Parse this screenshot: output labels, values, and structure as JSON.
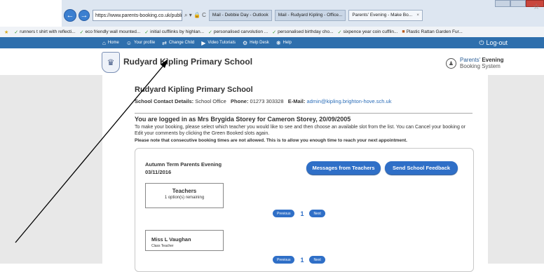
{
  "browser": {
    "url": "https://www.parents-booking.co.uk/public/b",
    "addr_icons": "⌕ ▾ 🔒 C",
    "tabs": [
      {
        "label": "Mail - Debbie Day - Outlook",
        "active": false
      },
      {
        "label": "Mail - Rudyard Kipling - Office...",
        "active": false
      },
      {
        "label": "Parents' Evening - Make Bo...",
        "active": true
      }
    ],
    "favorites": [
      "runners t shirt with reflecti...",
      "eco friendly wall mounted...",
      "initial cufflinks by highlan...",
      "personalised carvolution ...",
      "personalised birthday cho...",
      "sixpence year coin cufflin...",
      "Plastic Rattan Garden Fur..."
    ]
  },
  "site_nav": {
    "items": [
      {
        "icon": "home-icon",
        "label": "Home"
      },
      {
        "icon": "user-icon",
        "label": "Your profile"
      },
      {
        "icon": "switch-icon",
        "label": "Change Child"
      },
      {
        "icon": "video-icon",
        "label": "Video Tutorials"
      },
      {
        "icon": "helpdesk-icon",
        "label": "Help Desk"
      },
      {
        "icon": "help-icon",
        "label": "Help"
      }
    ],
    "logout_label": "Log-out"
  },
  "header": {
    "school_name": "Rudyard Kipling Primary School",
    "logo_line1_a": "Parents'",
    "logo_line1_b": "Evening",
    "logo_line2": "Booking System"
  },
  "main": {
    "school_title": "Rudyard Kipling Primary School",
    "contact_label": "School Contact Details:",
    "contact_office": "School Office",
    "phone_label": "Phone:",
    "phone_value": "01273 303328",
    "email_label": "E-Mail:",
    "email_value": "admin@kipling.brighton-hove.sch.uk",
    "logged_in": "You are logged in as Mrs Brygida Storey for Cameron Storey, 20/09/2005",
    "instructions": "To make your booking, please select which teacher you would like to see and then choose an available slot from the list. You can Cancel your booking or Edit your comments by clicking the Green Booked slots again.",
    "note": "Please note that consecutive booking times are not allowed. This is to allow you enough time to reach your next appointment.",
    "event_title": "Autumn Term Parents Evening",
    "event_date": "03/11/2016",
    "messages_button": "Messages from Teachers",
    "feedback_button": "Send School Feedback",
    "teachers_card_title": "Teachers",
    "teachers_card_sub": "1 option(s) remaining",
    "pager_prev": "Previous",
    "pager_page": "1",
    "pager_next": "Next",
    "teacher_name": "Miss L Vaughan",
    "teacher_role": "Class Teacher"
  },
  "colors": {
    "nav_blue": "#2e6fad",
    "button_blue": "#2f6fc7",
    "link_blue": "#2a6db8",
    "content_bg": "#e8e8e8"
  }
}
